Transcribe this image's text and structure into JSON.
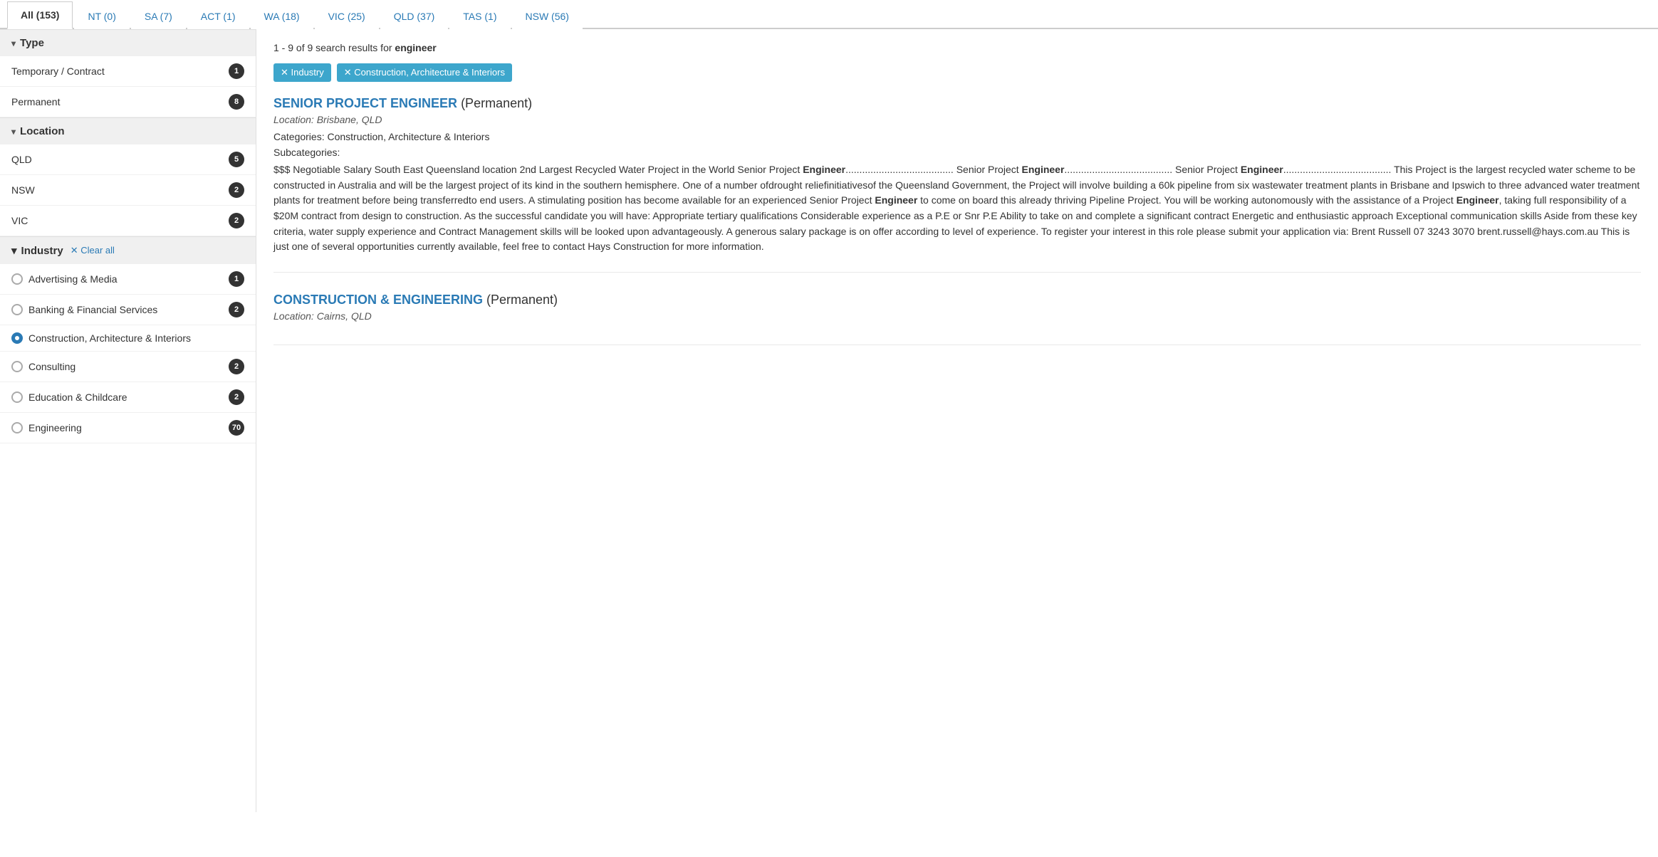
{
  "tabs": [
    {
      "id": "all",
      "label": "All (153)",
      "active": true
    },
    {
      "id": "nt",
      "label": "NT (0)",
      "active": false
    },
    {
      "id": "sa",
      "label": "SA (7)",
      "active": false
    },
    {
      "id": "act",
      "label": "ACT (1)",
      "active": false
    },
    {
      "id": "wa",
      "label": "WA (18)",
      "active": false
    },
    {
      "id": "vic",
      "label": "VIC (25)",
      "active": false
    },
    {
      "id": "qld",
      "label": "QLD (37)",
      "active": false
    },
    {
      "id": "tas",
      "label": "TAS (1)",
      "active": false
    },
    {
      "id": "nsw",
      "label": "NSW (56)",
      "active": false
    }
  ],
  "sidebar": {
    "type_header": "Type",
    "type_items": [
      {
        "label": "Permanent",
        "count": "8"
      },
      {
        "label": "Temporary / Contract",
        "count": "1"
      }
    ],
    "location_header": "Location",
    "location_items": [
      {
        "label": "QLD",
        "count": "5"
      },
      {
        "label": "NSW",
        "count": "2"
      },
      {
        "label": "VIC",
        "count": "2"
      }
    ],
    "industry_header": "Industry",
    "clear_all_label": "✕ Clear all",
    "industry_items": [
      {
        "label": "Advertising & Media",
        "count": "1",
        "selected": false
      },
      {
        "label": "Banking & Financial Services",
        "count": "2",
        "selected": false
      },
      {
        "label": "Construction, Architecture & Interiors",
        "count": "",
        "selected": true
      },
      {
        "label": "Consulting",
        "count": "2",
        "selected": false
      },
      {
        "label": "Education & Childcare",
        "count": "2",
        "selected": false
      },
      {
        "label": "Engineering",
        "count": "70",
        "selected": false
      }
    ]
  },
  "results": {
    "summary_prefix": "1 - 9 of 9 search results for ",
    "query": "engineer"
  },
  "filter_tags": [
    {
      "id": "industry-tag",
      "label": "✕ Industry"
    },
    {
      "id": "construction-tag",
      "label": "✕ Construction, Architecture & Interiors"
    }
  ],
  "jobs": [
    {
      "title": "SENIOR PROJECT ENGINEER",
      "type": "(Permanent)",
      "location": "Location: Brisbane, QLD",
      "categories": "Categories: Construction, Architecture & Interiors",
      "subcategories": "Subcategories:",
      "description": "$$$ Negotiable Salary South East Queensland location 2nd Largest Recycled Water Project in the World Senior Project Engineer........................................ Senior Project Engineer........................................ Senior Project Engineer........................................ This Project is the largest recycled water scheme to be constructed in Australia and will be the largest project of its kind in the southern hemisphere. One of a number ofdrought reliefinitiativesof the Queensland Government, the Project will involve building a 60k pipeline from six wastewater treatment plants in Brisbane and Ipswich to three advanced water treatment plants for treatment before being transferredto end users. A stimulating position has become available for an experienced Senior Project Engineer to come on board this already thriving Pipeline Project. You will be working autonomously with the assistance of a Project Engineer, taking full responsibility of a $20M contract from design to construction. As the successful candidate you will have: Appropriate tertiary qualifications Considerable experience as a P.E or Snr P.E Ability to take on and complete a significant contract Energetic and enthusiastic approach Exceptional communication skills Aside from these key criteria, water supply experience and Contract Management skills will be looked upon advantageously. A generous salary package is on offer according to level of experience. To register your interest in this role please submit your application via: Brent Russell 07 3243 3070 brent.russell@hays.com.au This is just one of several opportunities currently available, feel free to contact Hays Construction for more information."
    },
    {
      "title": "CONSTRUCTION & ENGINEERING",
      "type": "(Permanent)",
      "location": "Location: Cairns, QLD",
      "categories": "",
      "subcategories": "",
      "description": ""
    }
  ]
}
